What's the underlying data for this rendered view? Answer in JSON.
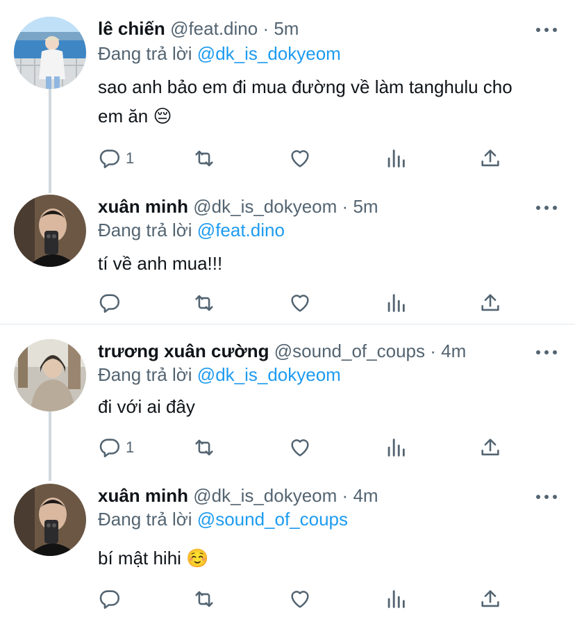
{
  "tweets": [
    {
      "name": "lê chiến",
      "handle": "@feat.dino",
      "sep": "·",
      "time": "5m",
      "reply_prefix": "Đang trả lời",
      "reply_handle": "@dk_is_dokyeom",
      "text": "sao anh bảo em đi mua đường về làm tanghulu cho em ăn 😔",
      "reply_count": "1"
    },
    {
      "name": "xuân minh",
      "handle": "@dk_is_dokyeom",
      "sep": "·",
      "time": "5m",
      "reply_prefix": "Đang trả lời",
      "reply_handle": "@feat.dino",
      "text": "tí về anh mua!!!",
      "reply_count": ""
    },
    {
      "name": "trương xuân cường",
      "handle": "@sound_of_coups",
      "sep": "·",
      "time": "4m",
      "reply_prefix": "Đang trả lời",
      "reply_handle": "@dk_is_dokyeom",
      "text": "đi với ai đây",
      "reply_count": "1"
    },
    {
      "name": "xuân minh",
      "handle": "@dk_is_dokyeom",
      "sep": "·",
      "time": "4m",
      "reply_prefix": "Đang trả lời",
      "reply_handle": "@sound_of_coups",
      "text": "bí mật hihi ☺️",
      "reply_count": ""
    }
  ],
  "icons": {
    "reply": "reply-icon",
    "retweet": "retweet-icon",
    "like": "heart-icon",
    "views": "analytics-icon",
    "share": "share-icon",
    "more": "more-icon"
  },
  "colors": {
    "link": "#1d9bf0",
    "secondary": "#536471",
    "text": "#0f1419",
    "thread_line": "#cfd9de"
  }
}
